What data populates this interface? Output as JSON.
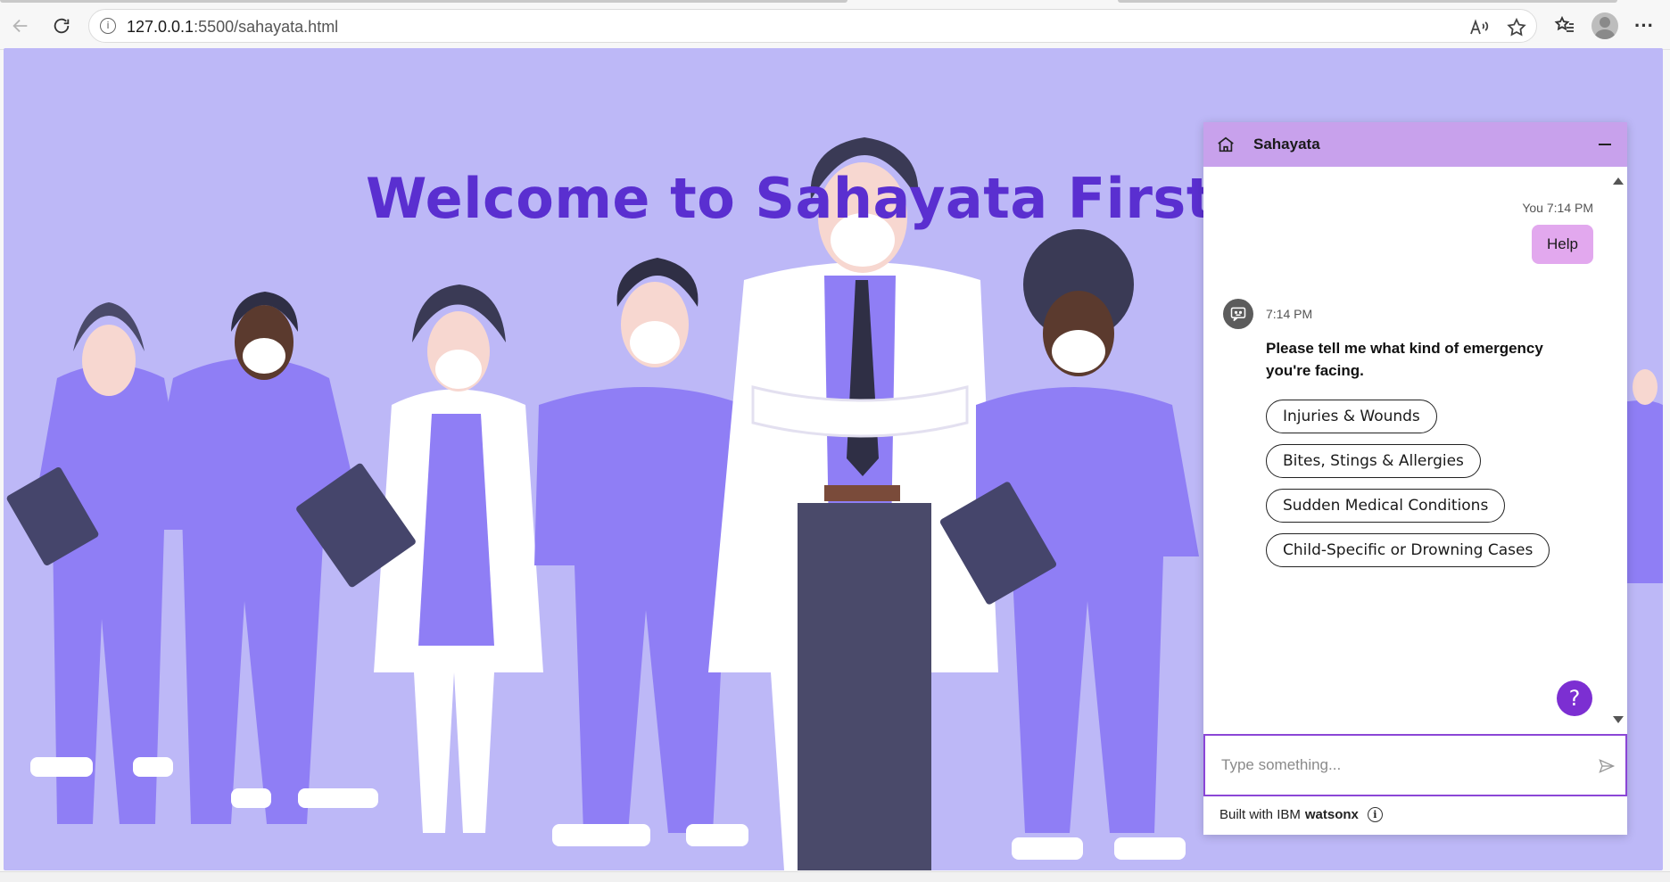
{
  "browser": {
    "url_host": "127.0.0.1",
    "url_path": ":5500/sahayata.html"
  },
  "page": {
    "title": "Welcome to Sahayata First Aid"
  },
  "chat": {
    "header_title": "Sahayata",
    "user_meta": "You 7:14 PM",
    "user_message": "Help",
    "bot_time": "7:14 PM",
    "bot_message": "Please tell me what kind of emergency you're facing.",
    "options": [
      "Injuries & Wounds",
      "Bites, Stings & Allergies",
      "Sudden Medical Conditions",
      "Child-Specific or Drowning Cases"
    ],
    "help_label": "?",
    "input_placeholder": "Type something...",
    "footer_prefix": "Built with IBM",
    "footer_brand": "watsonx",
    "footer_info": "i"
  },
  "colors": {
    "page_background": "#bdb8f7",
    "title": "#5a2fd0",
    "chat_header": "#c8a1ec",
    "user_bubble": "#e2a8ee",
    "help_button": "#7c2fd2",
    "scrubs": "#8f7ef5"
  },
  "icons": [
    "back-icon",
    "refresh-icon",
    "site-info-icon",
    "read-aloud-icon",
    "favorite-star-icon",
    "favorites-icon",
    "profile-avatar",
    "more-icon",
    "home-icon",
    "minimize-icon",
    "bot-avatar-icon",
    "help-icon",
    "send-icon",
    "info-icon"
  ]
}
